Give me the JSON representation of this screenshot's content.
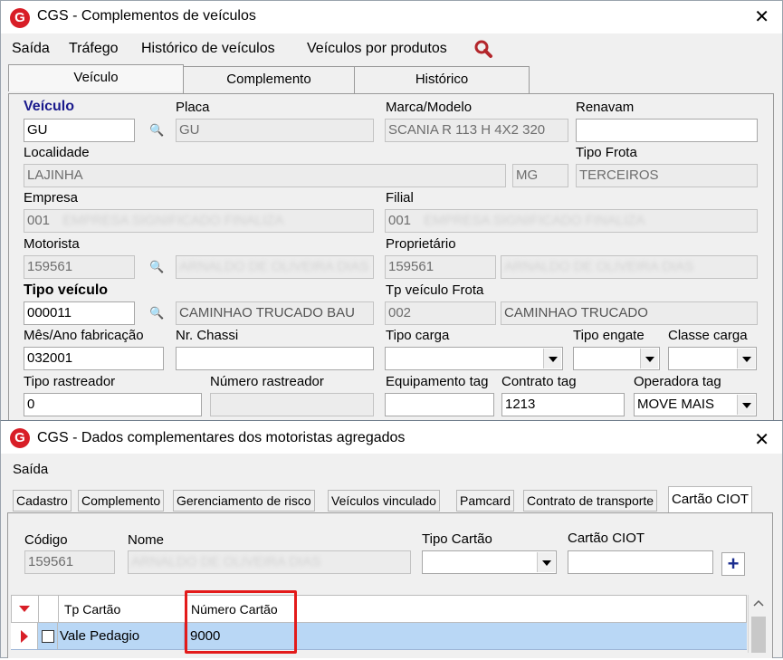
{
  "window1": {
    "title": "CGS - Complementos de veículos",
    "menu": [
      "Saída",
      "Tráfego",
      "Histórico de veículos",
      "Veículos por produtos"
    ],
    "tabs": [
      "Veículo",
      "Complemento",
      "Histórico"
    ],
    "labels": {
      "veiculo": "Veículo",
      "placa": "Placa",
      "marca_modelo": "Marca/Modelo",
      "renavam": "Renavam",
      "localidade": "Localidade",
      "tipo_frota": "Tipo Frota",
      "empresa": "Empresa",
      "filial": "Filial",
      "motorista": "Motorista",
      "proprietario": "Proprietário",
      "tipo_veiculo": "Tipo veículo",
      "tp_veiculo_frota": "Tp veículo Frota",
      "mes_ano_fabricacao": "Mês/Ano fabricação",
      "nr_chassi": "Nr. Chassi",
      "tipo_carga": "Tipo carga",
      "tipo_engate": "Tipo engate",
      "classe_carga": "Classe carga",
      "tipo_rastreador": "Tipo rastreador",
      "numero_rastreador": "Número rastreador",
      "equipamento_tag": "Equipamento tag",
      "contrato_tag": "Contrato tag",
      "operadora_tag": "Operadora tag"
    },
    "values": {
      "veiculo": "GU",
      "placa": "GU",
      "marca_modelo": "SCANIA R 113 H 4X2 320",
      "renavam": "",
      "localidade": "LAJINHA",
      "uf": "MG",
      "tipo_frota": "TERCEIROS",
      "empresa_code": "001",
      "empresa_name": "EMPRESA SIGNIFICADO FINALIZA",
      "filial_code": "001",
      "filial_name": "EMPRESA SIGNIFICADO FINALIZA",
      "motorista_code": "159561",
      "motorista_name": "ARNALDO DE OLIVEIRA DIAS",
      "proprietario_code": "159561",
      "proprietario_name": "ARNALDO DE OLIVEIRA DIAS",
      "tipo_veiculo_code": "000011",
      "tipo_veiculo_desc": "CAMINHAO TRUCADO BAU",
      "tp_veiculo_frota_code": "002",
      "tp_veiculo_frota_desc": "CAMINHAO TRUCADO",
      "mes_ano_fabricacao": "032001",
      "nr_chassi": "",
      "tipo_carga": "",
      "tipo_engate": "",
      "classe_carga": "",
      "tipo_rastreador": "0",
      "numero_rastreador": "",
      "equipamento_tag": "",
      "contrato_tag": "1213",
      "operadora_tag": "MOVE MAIS"
    }
  },
  "window2": {
    "title": "CGS - Dados complementares dos motoristas agregados",
    "menu": [
      "Saída"
    ],
    "tabs": [
      "Cadastro",
      "Complemento",
      "Gerenciamento de risco",
      "Veículos vinculado",
      "Pamcard",
      "Contrato de transporte",
      "Cartão CIOT"
    ],
    "labels": {
      "codigo": "Código",
      "nome": "Nome",
      "tipo_cartao": "Tipo Cartão",
      "cartao_ciot": "Cartão CIOT"
    },
    "values": {
      "codigo": "159561",
      "nome": "ARNALDO DE OLIVEIRA DIAS",
      "tipo_cartao": "",
      "cartao_ciot": ""
    },
    "add_label": "+",
    "grid": {
      "columns": [
        "Tp Cartão",
        "Número Cartão"
      ],
      "rows": [
        {
          "tp_cartao": "Vale Pedagio",
          "numero_cartao": "9000"
        }
      ]
    }
  },
  "colors": {
    "accent": "#d81e27",
    "highlight_box": "#e31b1b",
    "selected_row": "#b9d7f5",
    "label_blue": "#1a1a8c"
  }
}
